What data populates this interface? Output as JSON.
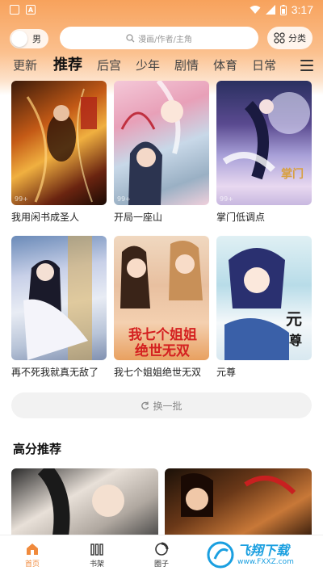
{
  "status_bar": {
    "time": "3:17",
    "app_icon_letter": "A"
  },
  "header": {
    "gender_label": "男",
    "search_placeholder": "漫画/作者/主角",
    "category_label": "分类"
  },
  "tabs": [
    {
      "label": "更新",
      "active": false
    },
    {
      "label": "推荐",
      "active": true
    },
    {
      "label": "后宫",
      "active": false
    },
    {
      "label": "少年",
      "active": false
    },
    {
      "label": "剧情",
      "active": false
    },
    {
      "label": "体育",
      "active": false
    },
    {
      "label": "日常",
      "active": false
    }
  ],
  "comics": [
    {
      "title": "我用闲书成圣人",
      "cover_label": "99+"
    },
    {
      "title": "开局一座山",
      "cover_label": "99+"
    },
    {
      "title": "掌门低调点",
      "cover_label": "99+"
    },
    {
      "title": "再不死我就真无敌了",
      "cover_label": ""
    },
    {
      "title": "我七个姐姐绝世无双",
      "cover_label": ""
    },
    {
      "title": "元尊",
      "cover_label": ""
    }
  ],
  "refresh_label": "换一批",
  "section_title": "高分推荐",
  "bottom_nav": [
    {
      "label": "首页",
      "active": true
    },
    {
      "label": "书架",
      "active": false
    },
    {
      "label": "圈子",
      "active": false
    },
    {
      "label": "",
      "active": false
    },
    {
      "label": "",
      "active": false
    }
  ],
  "watermark": {
    "main": "飞翔下载",
    "sub": "www.FXXZ.com"
  },
  "colors": {
    "accent": "#f08a3c",
    "header_gradient_top": "#f7a25c"
  }
}
